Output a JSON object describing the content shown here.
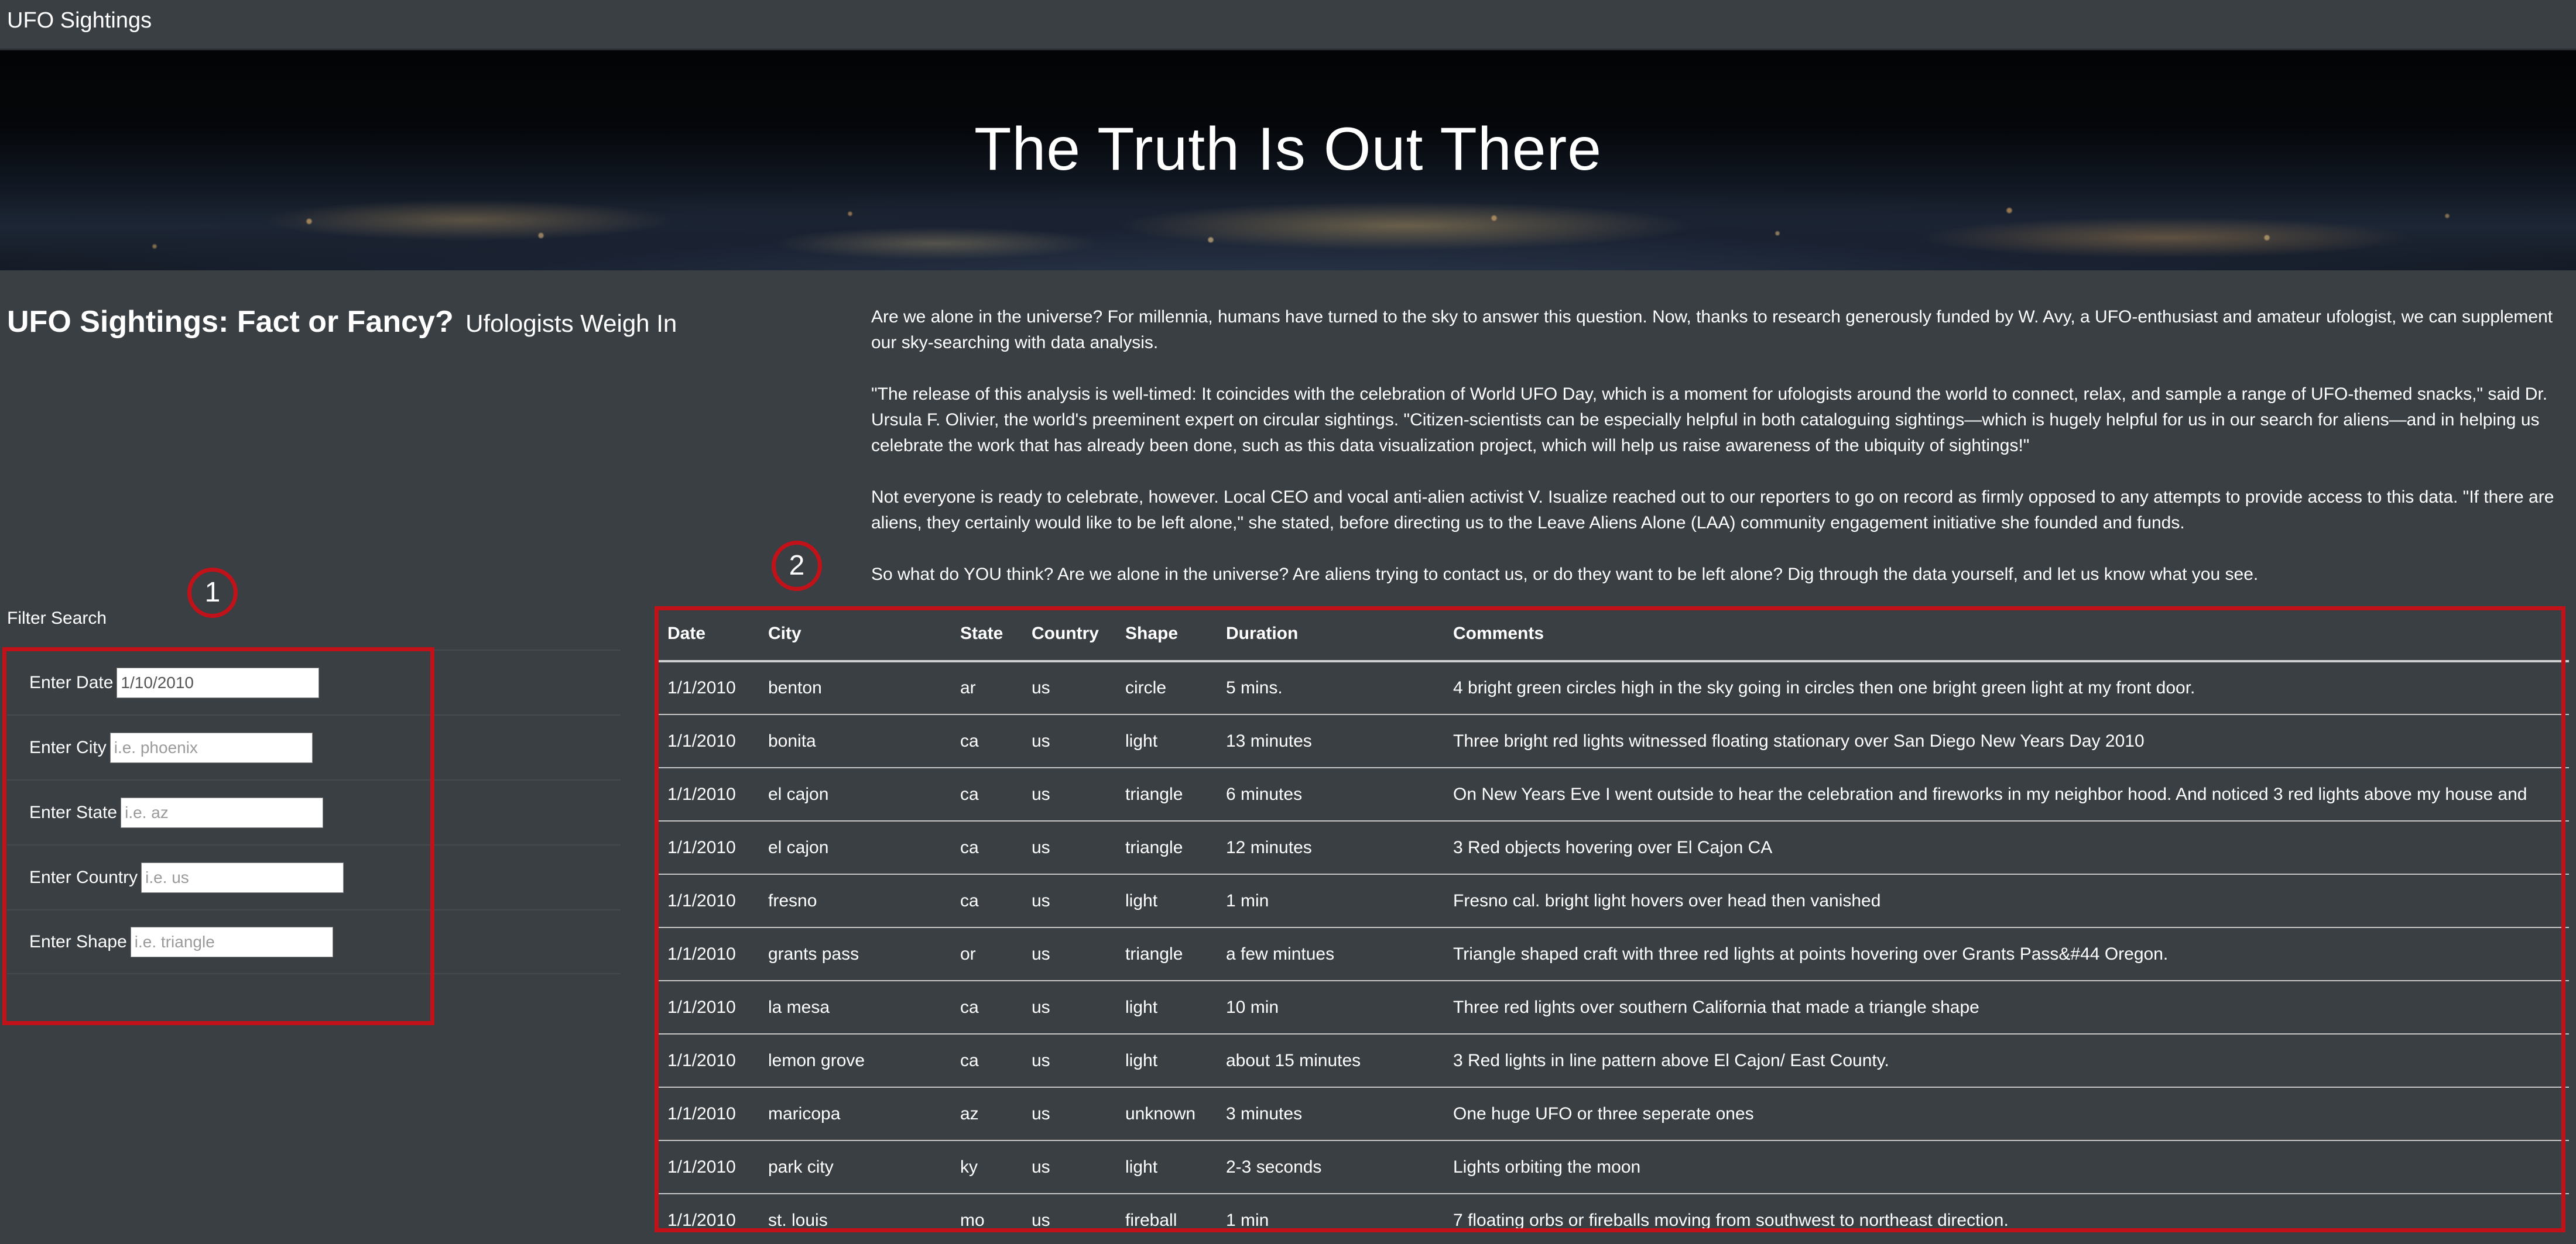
{
  "navbar": {
    "brand": "UFO Sightings"
  },
  "hero": {
    "title": "The Truth Is Out There"
  },
  "heading": {
    "main": "UFO Sightings: Fact or Fancy?",
    "sub": "Ufologists Weigh In"
  },
  "article": {
    "paragraphs": [
      "Are we alone in the universe? For millennia, humans have turned to the sky to answer this question. Now, thanks to research generously funded by W. Avy, a UFO-enthusiast and amateur ufologist, we can supplement our sky-searching with data analysis.",
      "\"The release of this analysis is well-timed: It coincides with the celebration of World UFO Day, which is a moment for ufologists around the world to connect, relax, and sample a range of UFO-themed snacks,\" said Dr. Ursula F. Olivier, the world's preeminent expert on circular sightings. \"Citizen-scientists can be especially helpful in both cataloguing sightings—which is hugely helpful for us in our search for aliens—and in helping us celebrate the work that has already been done, such as this data visualization project, which will help us raise awareness of the ubiquity of sightings!\"",
      "Not everyone is ready to celebrate, however. Local CEO and vocal anti-alien activist V. Isualize reached out to our reporters to go on record as firmly opposed to any attempts to provide access to this data. \"If there are aliens, they certainly would like to be left alone,\" she stated, before directing us to the Leave Aliens Alone (LAA) community engagement initiative she founded and funds.",
      "So what do YOU think? Are we alone in the universe? Are aliens trying to contact us, or do they want to be left alone? Dig through the data yourself, and let us know what you see."
    ]
  },
  "filters": {
    "title": "Filter Search",
    "items": [
      {
        "label": "Enter Date",
        "value": "1/10/2010",
        "placeholder": "1/10/2010"
      },
      {
        "label": "Enter City",
        "value": "",
        "placeholder": "i.e. phoenix"
      },
      {
        "label": "Enter State",
        "value": "",
        "placeholder": "i.e. az"
      },
      {
        "label": "Enter Country",
        "value": "",
        "placeholder": "i.e. us"
      },
      {
        "label": "Enter Shape",
        "value": "",
        "placeholder": "i.e. triangle"
      }
    ]
  },
  "table": {
    "headers": [
      "Date",
      "City",
      "State",
      "Country",
      "Shape",
      "Duration",
      "Comments"
    ],
    "rows": [
      [
        "1/1/2010",
        "benton",
        "ar",
        "us",
        "circle",
        "5 mins.",
        "4 bright green circles high in the sky going in circles then one bright green light at my front door."
      ],
      [
        "1/1/2010",
        "bonita",
        "ca",
        "us",
        "light",
        "13 minutes",
        "Three bright red lights witnessed floating stationary over San Diego New Years Day 2010"
      ],
      [
        "1/1/2010",
        "el cajon",
        "ca",
        "us",
        "triangle",
        "6 minutes",
        "On New Years Eve I went outside to hear the celebration and fireworks in my neighbor hood. And noticed 3 red lights above my house and"
      ],
      [
        "1/1/2010",
        "el cajon",
        "ca",
        "us",
        "triangle",
        "12 minutes",
        "3 Red objects hovering over El Cajon CA"
      ],
      [
        "1/1/2010",
        "fresno",
        "ca",
        "us",
        "light",
        "1 min",
        "Fresno cal. bright light hovers over head then vanished"
      ],
      [
        "1/1/2010",
        "grants pass",
        "or",
        "us",
        "triangle",
        "a few mintues",
        "Triangle shaped craft with three red lights at points hovering over Grants Pass&#44 Oregon."
      ],
      [
        "1/1/2010",
        "la mesa",
        "ca",
        "us",
        "light",
        "10 min",
        "Three red lights over southern California that made a triangle shape"
      ],
      [
        "1/1/2010",
        "lemon grove",
        "ca",
        "us",
        "light",
        "about 15 minutes",
        "3 Red lights in line pattern above El Cajon/ East County."
      ],
      [
        "1/1/2010",
        "maricopa",
        "az",
        "us",
        "unknown",
        "3 minutes",
        "One huge UFO or three seperate ones"
      ],
      [
        "1/1/2010",
        "park city",
        "ky",
        "us",
        "light",
        "2-3 seconds",
        "Lights orbiting the moon"
      ],
      [
        "1/1/2010",
        "st. louis",
        "mo",
        "us",
        "fireball",
        "1 min",
        "7 floating orbs or fireballs moving from southwest to northeast direction."
      ]
    ]
  },
  "callouts": [
    "1",
    "2"
  ],
  "colors": {
    "background": "#3a3f44",
    "callout": "#c1121a"
  }
}
